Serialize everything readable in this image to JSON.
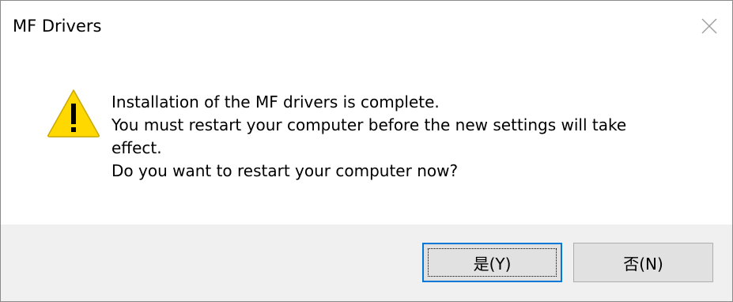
{
  "dialog": {
    "title": "MF Drivers",
    "close_icon": "close-icon",
    "icon": "warning-icon",
    "message_lines": [
      "Installation of the MF drivers is complete.",
      "You must restart your computer before the new settings will take",
      "effect.",
      "Do you want to restart your computer now?"
    ],
    "buttons": {
      "yes_label": "是(Y)",
      "no_label": "否(N)"
    },
    "colors": {
      "warning_fill": "#FFD800",
      "focus_border": "#0078D7",
      "footer_bg": "#F0F0F0"
    }
  }
}
